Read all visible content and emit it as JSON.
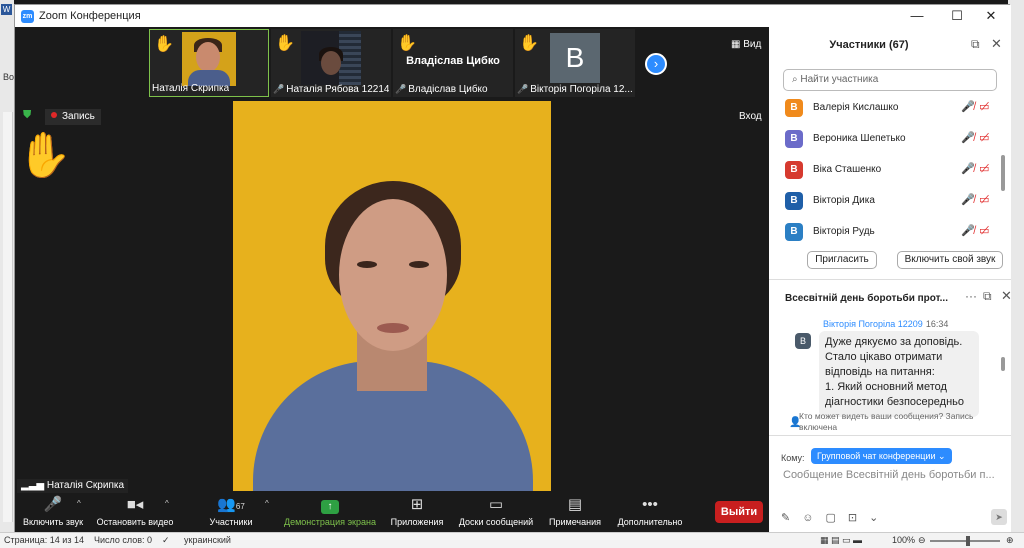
{
  "window": {
    "title": "Zoom Конференция"
  },
  "thumbnails": [
    {
      "name": "Наталія Скрипка",
      "muted": false
    },
    {
      "name": "Наталія Рябова 12214",
      "muted": true
    },
    {
      "name": "Владіслав Цибко",
      "muted": true,
      "display": "Владіслав Цибко"
    },
    {
      "name": "Вікторія Погоріла 12...",
      "muted": true,
      "letter": "В"
    }
  ],
  "top_controls": {
    "view": "Вид",
    "enter": "Вход"
  },
  "recording": {
    "label": "Запись"
  },
  "speaker_name": "Наталія Скрипка",
  "toolbar": {
    "audio": "Включить звук",
    "video": "Остановить видео",
    "participants": "Участники",
    "participants_count": "67",
    "share": "Демонстрация экрана",
    "apps": "Приложения",
    "whiteboards": "Доски сообщений",
    "notes": "Примечания",
    "more": "Дополнительно",
    "leave": "Выйти"
  },
  "participants_panel": {
    "title": "Участники (67)",
    "search_placeholder": "Найти участника",
    "list": [
      {
        "initial": "В",
        "name": "Валерія Кислашко",
        "color": "#f08a1c"
      },
      {
        "initial": "В",
        "name": "Вероника Шепетько",
        "color": "#6b6bc9"
      },
      {
        "initial": "В",
        "name": "Віка Сташенко",
        "color": "#d63a2f"
      },
      {
        "initial": "В",
        "name": "Вікторія Дика",
        "color": "#1f5fa8"
      },
      {
        "initial": "В",
        "name": "Вікторія Рудь",
        "color": "#2b7fc4"
      }
    ],
    "invite": "Пригласить",
    "unmute_me": "Включить свой звук"
  },
  "chat_panel": {
    "title": "Всесвітній день боротьби прот...",
    "sender": "Вікторія Погоріла 12209",
    "time": "16:34",
    "sender_initial": "В",
    "message_lines": [
      "Дуже дякуємо за доповідь.",
      "Стало цікаво отримати",
      "відповідь на питання:",
      "1. Який основний метод",
      "діагностики безпосередньо"
    ],
    "visibility_note": "Кто может видеть ваши сообщения? Запись включена",
    "to_label": "Кому:",
    "to_value": "Групповой чат конференции",
    "composer_placeholder": "Сообщение Всесвітній день боротьби п..."
  },
  "word_status": {
    "page": "Страница: 14 из 14",
    "words": "Число слов: 0",
    "language": "украинский",
    "zoom": "100%"
  },
  "colors": {
    "accent": "#2d8cff",
    "leave": "#c81f1f",
    "share": "#2ea043",
    "speaker_bg": "#e7b11d"
  }
}
